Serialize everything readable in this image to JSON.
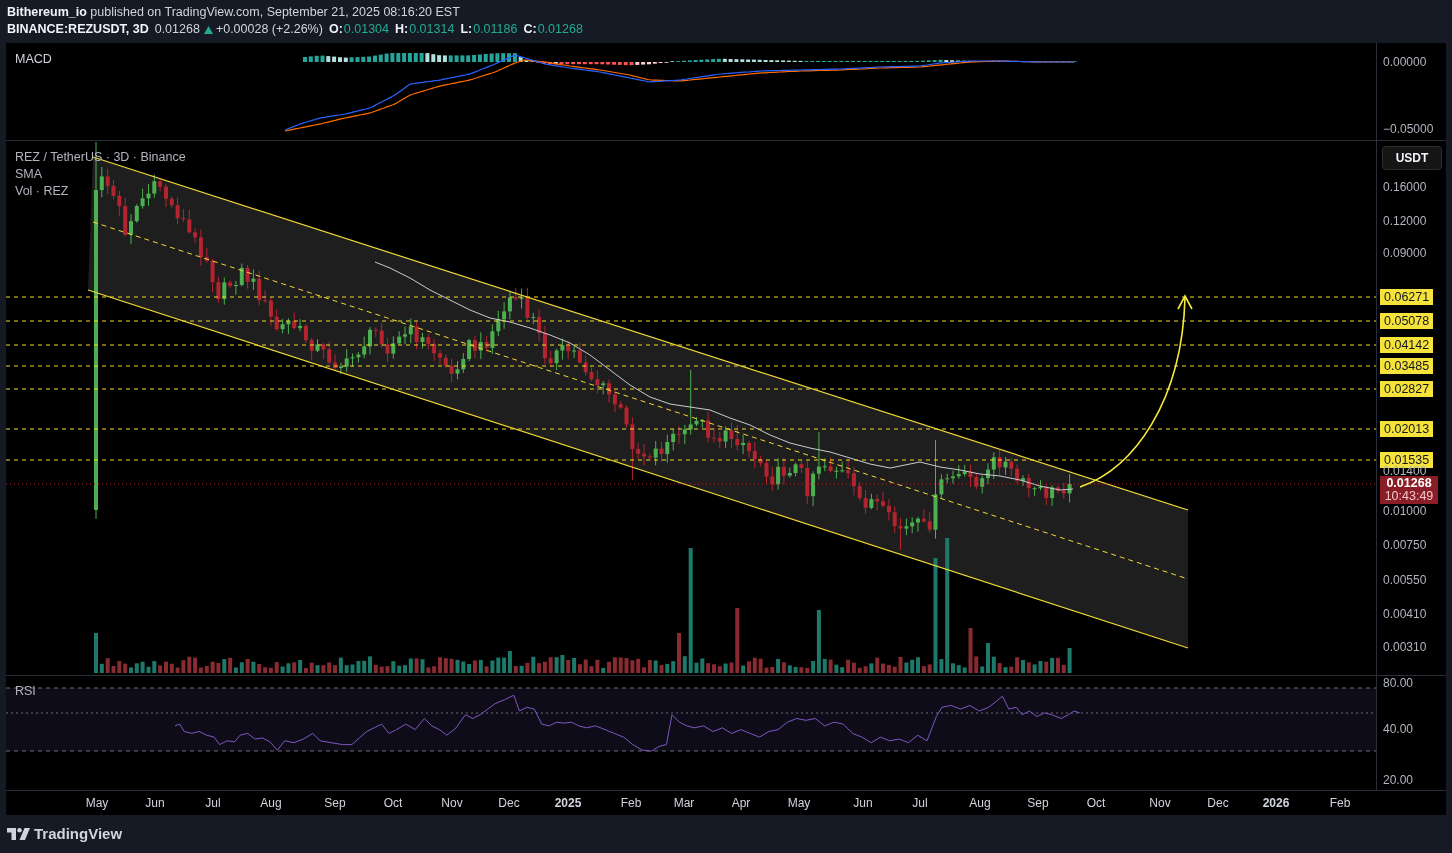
{
  "header": {
    "publisher_line": "**Bithereum_io** published on TradingView.com, September 21, 2025 08:16:20 EST",
    "symbol": "BINANCE:REZUSDT, 3D",
    "last": "0.01268",
    "price_up": true,
    "change": "+0.00028 (+2.26%)",
    "ohlc": [
      {
        "label": "O:",
        "value": "0.01304"
      },
      {
        "label": "H:",
        "value": "0.01314"
      },
      {
        "label": "L:",
        "value": "0.01186"
      },
      {
        "label": "C:",
        "value": "0.01268"
      }
    ]
  },
  "macd_pane": {
    "title": "MACD",
    "axis_labels": [
      "0.00000",
      "−0.05000"
    ]
  },
  "price_pane": {
    "legend": [
      "REZ / TetherUS · 3D · Binance",
      "SMA",
      "Vol · REZ"
    ],
    "currency_button": "USDT",
    "axis_labels": [
      "0.16000",
      "0.12000",
      "0.09000",
      "0.01400",
      "0.01000",
      "0.00750",
      "0.00550",
      "0.00410",
      "0.00310"
    ],
    "levels": [
      "0.06271",
      "0.05078",
      "0.04142",
      "0.03485",
      "0.02827",
      "0.02013",
      "0.01535"
    ],
    "current_price": {
      "value": "0.01268",
      "countdown": "10:43:49"
    }
  },
  "rsi_pane": {
    "title": "RSI",
    "axis_labels": [
      "80.00",
      "40.00",
      "20.00"
    ]
  },
  "time_axis": [
    {
      "label": "May",
      "kind": "month"
    },
    {
      "label": "Jun",
      "kind": "month"
    },
    {
      "label": "Jul",
      "kind": "month"
    },
    {
      "label": "Aug",
      "kind": "month"
    },
    {
      "label": "Sep",
      "kind": "month"
    },
    {
      "label": "Oct",
      "kind": "month"
    },
    {
      "label": "Nov",
      "kind": "month"
    },
    {
      "label": "Dec",
      "kind": "month"
    },
    {
      "label": "2025",
      "kind": "year"
    },
    {
      "label": "Feb",
      "kind": "month"
    },
    {
      "label": "Mar",
      "kind": "month"
    },
    {
      "label": "Apr",
      "kind": "month"
    },
    {
      "label": "May",
      "kind": "month"
    },
    {
      "label": "Jun",
      "kind": "month"
    },
    {
      "label": "Jul",
      "kind": "month"
    },
    {
      "label": "Aug",
      "kind": "month"
    },
    {
      "label": "Sep",
      "kind": "month"
    },
    {
      "label": "Oct",
      "kind": "month"
    },
    {
      "label": "Nov",
      "kind": "month"
    },
    {
      "label": "Dec",
      "kind": "month"
    },
    {
      "label": "2026",
      "kind": "year"
    },
    {
      "label": "Feb",
      "kind": "month"
    }
  ],
  "footer": {
    "brand": "TradingView"
  }
}
